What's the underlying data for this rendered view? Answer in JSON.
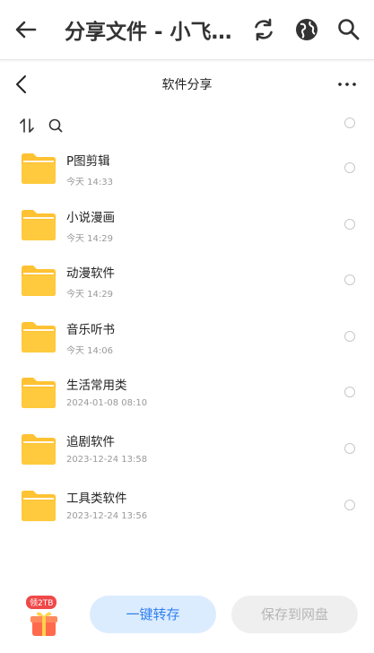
{
  "appbar": {
    "title": "分享文件 - 小飞…",
    "icons": [
      "back-arrow-icon",
      "refresh-icon",
      "globe-icon",
      "search-icon"
    ]
  },
  "subheader": {
    "title": "软件分享",
    "icons": [
      "chevron-left-icon",
      "more-icon"
    ]
  },
  "toolbar": {
    "icons": [
      "sort-icon",
      "search-icon"
    ]
  },
  "files": [
    {
      "name": "P图剪辑",
      "date": "今天 14:33"
    },
    {
      "name": "小说漫画",
      "date": "今天 14:29"
    },
    {
      "name": "动漫软件",
      "date": "今天 14:29"
    },
    {
      "name": "音乐听书",
      "date": "今天 14:06"
    },
    {
      "name": "生活常用类",
      "date": "2024-01-08 08:10"
    },
    {
      "name": "追剧软件",
      "date": "2023-12-24 13:58"
    },
    {
      "name": "工具类软件",
      "date": "2023-12-24 13:56"
    }
  ],
  "bottom": {
    "gift_badge": "领2TB",
    "primary_label": "一键转存",
    "secondary_label": "保存到网盘"
  },
  "colors": {
    "folder": "#ffc233",
    "primary": "#2f7ff0",
    "badge": "#f04848"
  }
}
